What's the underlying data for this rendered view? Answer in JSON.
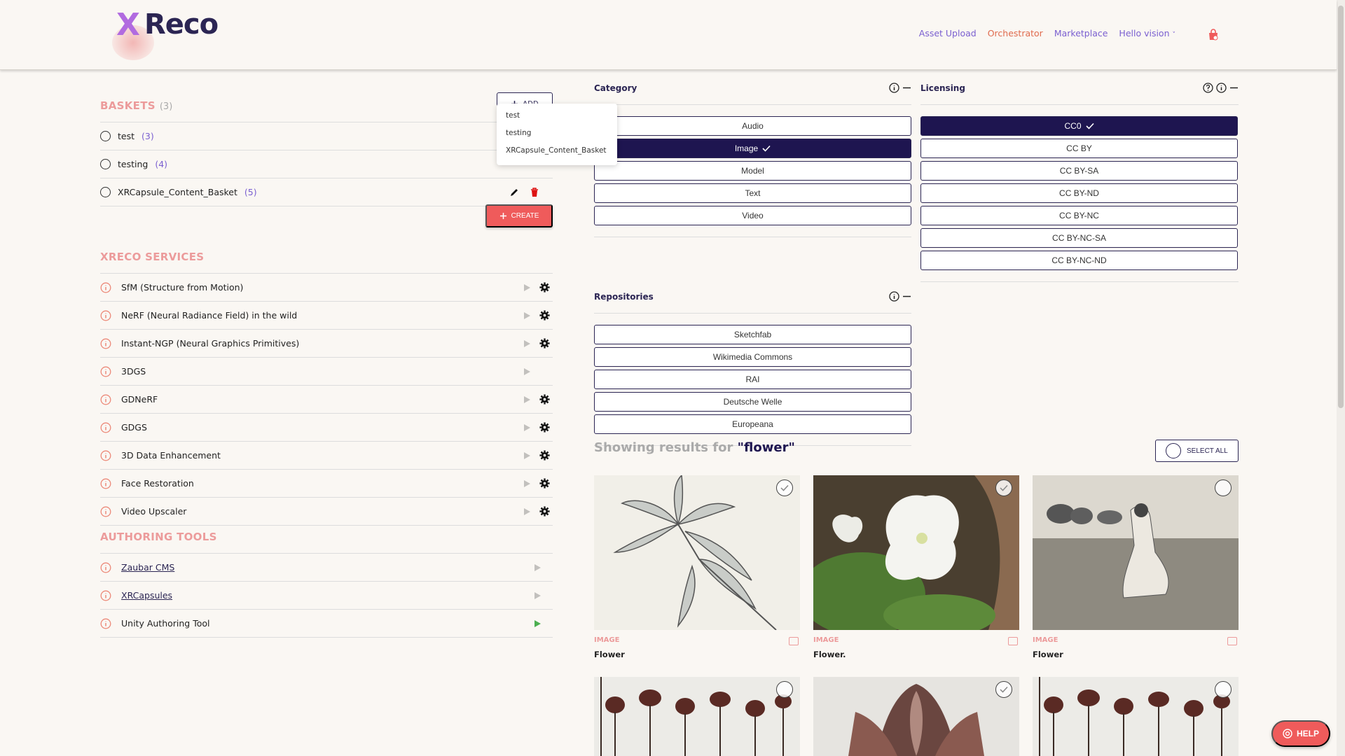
{
  "header": {
    "logo_text": "Reco",
    "logo_x": "X",
    "nav": [
      "Asset Upload",
      "Orchestrator",
      "Marketplace"
    ],
    "hello": "Hello vision",
    "hello_caret": "˅"
  },
  "baskets": {
    "title": "BASKETS",
    "count": "(3)",
    "add_label": "ADD",
    "dropdown": [
      "test",
      "testing",
      "XRCapsule_Content_Basket"
    ],
    "items": [
      {
        "name": "test",
        "count": "(3)"
      },
      {
        "name": "testing",
        "count": "(4)"
      },
      {
        "name": "XRCapsule_Content_Basket",
        "count": "(5)"
      }
    ],
    "create_label": "CREATE"
  },
  "services": {
    "title": "XRECO SERVICES",
    "items": [
      "SfM (Structure from Motion)",
      "NeRF (Neural Radiance Field) in the wild",
      "Instant-NGP (Neural Graphics Primitives)",
      "3DGS",
      "GDNeRF",
      "GDGS",
      "3D Data Enhancement",
      "Face Restoration",
      "Video Upscaler"
    ]
  },
  "authoring": {
    "title": "AUTHORING TOOLS",
    "items": [
      "Zaubar CMS",
      "XRCapsules",
      "Unity Authoring Tool"
    ]
  },
  "filters": {
    "category": {
      "title": "Category",
      "options": [
        "Audio",
        "Image",
        "Model",
        "Text",
        "Video"
      ],
      "selected": "Image"
    },
    "licensing": {
      "title": "Licensing",
      "options": [
        "CC0",
        "CC BY",
        "CC BY-SA",
        "CC BY-ND",
        "CC BY-NC",
        "CC BY-NC-SA",
        "CC BY-NC-ND"
      ],
      "selected": "CC0"
    },
    "repositories": {
      "title": "Repositories",
      "options": [
        "Sketchfab",
        "Wikimedia Commons",
        "RAI",
        "Deutsche Welle",
        "Europeana"
      ]
    }
  },
  "results": {
    "prefix": "Showing results for",
    "query": "\"flower\"",
    "select_all": "SELECT ALL",
    "cards": [
      {
        "type": "IMAGE",
        "caption": "Flower"
      },
      {
        "type": "IMAGE",
        "caption": "Flower."
      },
      {
        "type": "IMAGE",
        "caption": "Flower"
      }
    ]
  },
  "help_label": "HELP",
  "colors": {
    "accent": "#ef5b5b",
    "primary": "#1e1550",
    "link": "#7a5fd0"
  }
}
